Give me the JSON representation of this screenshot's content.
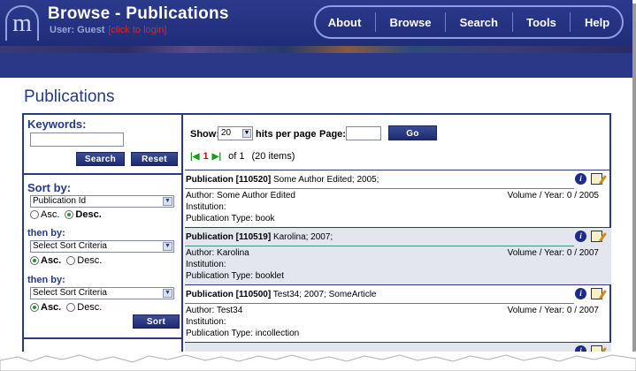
{
  "header": {
    "logo_letter": "m",
    "title": "Browse - Publications",
    "user_prefix": "User: Guest",
    "login_link": "[click to login]",
    "nav": [
      "About",
      "Browse",
      "Search",
      "Tools",
      "Help"
    ]
  },
  "section_title": "Publications",
  "sidebar": {
    "keywords_label": "Keywords:",
    "search_button": "Search",
    "reset_button": "Reset",
    "sort_by_label": "Sort by:",
    "sort1": {
      "value": "Publication Id",
      "asc": "Asc.",
      "desc": "Desc.",
      "selected": "desc"
    },
    "then_by_label": "then by:",
    "sort2": {
      "value": "Select Sort Criteria",
      "asc": "Asc.",
      "desc": "Desc.",
      "selected": "asc"
    },
    "sort3": {
      "value": "Select Sort Criteria",
      "asc": "Asc.",
      "desc": "Desc.",
      "selected": "asc"
    },
    "sort_button": "Sort"
  },
  "toolbar": {
    "show_label": "Show:",
    "hits_value": "20",
    "hits_label": "hits per page",
    "page_label": "Page:",
    "go_button": "Go",
    "current_page": "1",
    "of_pages": "of 1",
    "items": "(20 items)"
  },
  "records": [
    {
      "label": "Publication [110520]",
      "rest": "Some Author Edited; 2005;",
      "author": "Author: Some Author Edited",
      "institution": "Institution:",
      "type": "Publication Type: book",
      "volume": "Volume / Year: 0 / 2005"
    },
    {
      "label": "Publication [110519]",
      "rest": "Karolina; 2007;",
      "author": "Author: Karolina",
      "institution": "Institution:",
      "type": "Publication Type: booklet",
      "volume": "Volume / Year: 0 / 2007"
    },
    {
      "label": "Publication [110500]",
      "rest": "Test34; 2007; SomeArticle",
      "author": "Author: Test34",
      "institution": "Institution:",
      "type": "Publication Type: incollection",
      "volume": "Volume / Year: 0 / 2007"
    }
  ]
}
